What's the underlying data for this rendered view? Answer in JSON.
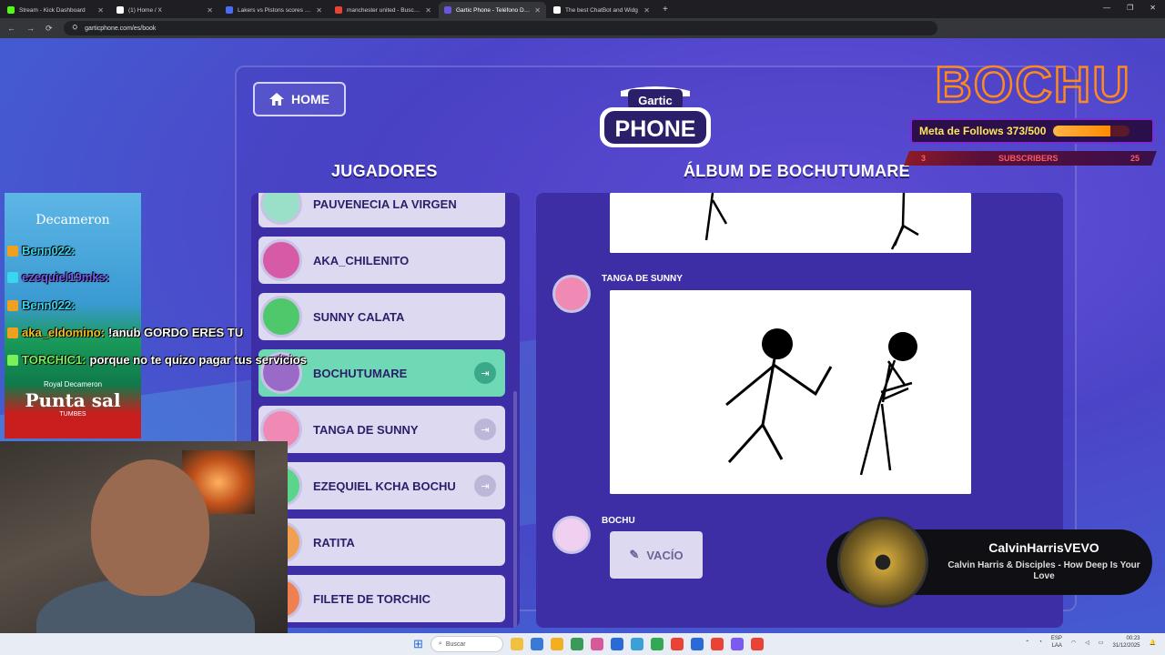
{
  "browser": {
    "tabs": [
      {
        "title": "Stream - Kick Dashboard",
        "color": "#53fc18",
        "active": false
      },
      {
        "title": "(1) Home / X",
        "color": "#ffffff",
        "active": false
      },
      {
        "title": "Lakers vs Pistons scores & predi",
        "color": "#4a6cf7",
        "active": false
      },
      {
        "title": "manchester united - Buscar con",
        "color": "#ea4335",
        "active": false
      },
      {
        "title": "Gartic Phone - Teléfono Descon",
        "color": "#6a55e0",
        "active": true
      },
      {
        "title": "The best ChatBot and Widg",
        "color": "#ffffff",
        "active": false
      }
    ],
    "new_tab": "+",
    "url": "garticphone.com/es/book"
  },
  "game": {
    "home_label": "HOME",
    "logo_top": "Gartic",
    "logo_bottom": "PHONE",
    "players_title": "JUGADORES",
    "album_title": "ÁLBUM DE BOCHUTUMARE",
    "players": [
      {
        "name": "PAUVENECIA LA VIRGEN",
        "avatar_color": "#9adfc8",
        "selected": false,
        "exit": false
      },
      {
        "name": "AKA_CHILENITO",
        "avatar_color": "#d65aa6",
        "selected": false,
        "exit": false
      },
      {
        "name": "SUNNY CALATA",
        "avatar_color": "#4ec86a",
        "selected": false,
        "exit": false
      },
      {
        "name": "BOCHUTUMARE",
        "avatar_color": "#9a6ac8",
        "selected": true,
        "exit": true
      },
      {
        "name": "TANGA DE SUNNY",
        "avatar_color": "#f08ab4",
        "selected": false,
        "exit": true
      },
      {
        "name": "EZEQUIEL KCHA BOCHU",
        "avatar_color": "#5ad68a",
        "selected": false,
        "exit": true
      },
      {
        "name": "RATITA",
        "avatar_color": "#f0a050",
        "selected": false,
        "exit": false
      },
      {
        "name": "FILETE DE TORCHIC",
        "avatar_color": "#f08050",
        "selected": false,
        "exit": false
      }
    ],
    "album": {
      "entries": [
        {
          "author": "TANGA DE SUNNY",
          "avatar_color": "#f08ab4"
        },
        {
          "author": "BOCHU",
          "avatar_color": "#f0d0f0"
        }
      ],
      "empty_label": "VACÍO"
    }
  },
  "overlay": {
    "brand": "BOCHU",
    "follows_label": "Meta de Follows 373/500",
    "follows_progress": 0.746,
    "subscribers_left": "3",
    "subscribers_label": "SUBSCRIBERS",
    "subscribers_right": "25"
  },
  "chat": {
    "ad_top": "Decameron",
    "ad_mid_small": "Royal Decameron",
    "ad_mid_big": "Punta sal",
    "ad_mid_sub": "TUMBES",
    "messages": [
      {
        "user": "Benn022:",
        "text": "",
        "color": "#3ad6f0",
        "badge": "#f0a020"
      },
      {
        "user": "ezequiel19mks:",
        "text": "",
        "color": "#7a5af0",
        "badge": "#3ad6f0"
      },
      {
        "user": "Benn022:",
        "text": "",
        "color": "#3ad6f0",
        "badge": "#f0a020"
      },
      {
        "user": "aka_eldomino:",
        "text": "!anub GORDO ERES TU",
        "color": "#f0c020",
        "badge": "#f0a020"
      },
      {
        "user": "TORCHIC1:",
        "text": "porque no te quizo pagar tus servicios",
        "color": "#7af05a",
        "badge": "#7af05a"
      }
    ]
  },
  "music": {
    "channel": "CalvinHarrisVEVO",
    "song": "Calvin Harris & Disciples - How Deep Is Your Love"
  },
  "taskbar": {
    "search_label": "Buscar",
    "lang": "ESP",
    "lang2": "LAA",
    "time": "00:23",
    "date": "31/12/2025",
    "icons": [
      "#f0c040",
      "#3a7ad6",
      "#f0b020",
      "#3a9a5a",
      "#d65a9a",
      "#2a6ad6",
      "#3aa0d6",
      "#34a853",
      "#ea4335",
      "#2a6ad6",
      "#ea4335",
      "#7a5af0",
      "#ea4335"
    ]
  }
}
